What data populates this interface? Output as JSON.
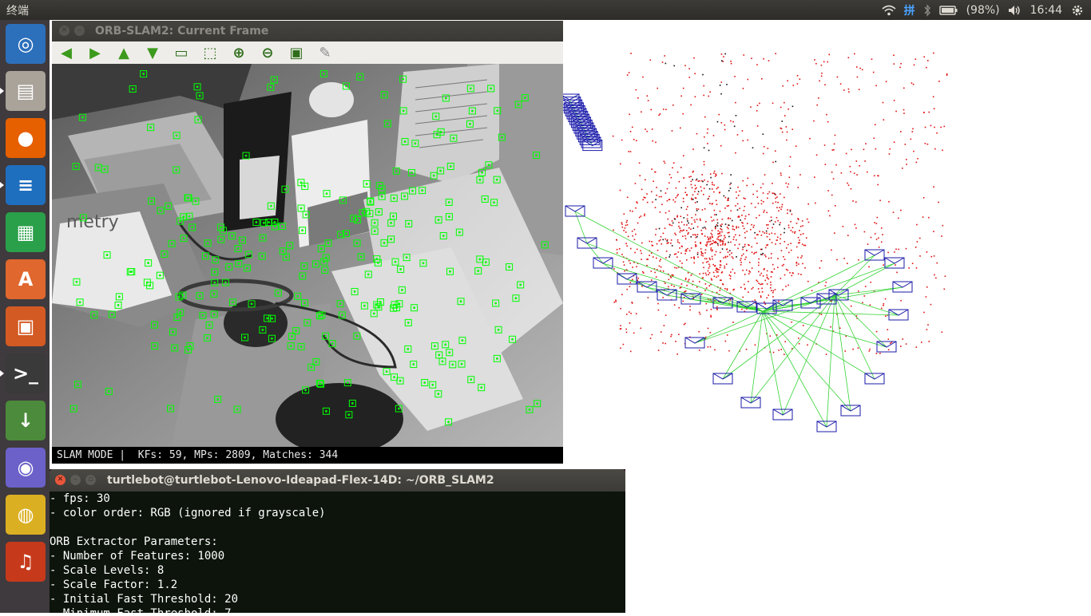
{
  "topbar": {
    "app_name": "终端",
    "battery": "(98%)",
    "clock": "16:44",
    "icons": [
      "wifi-icon",
      "input-method-icon",
      "bluetooth-icon",
      "battery-icon",
      "volume-icon",
      "settings-gear-icon"
    ],
    "ime_label": "拼"
  },
  "launcher": {
    "items": [
      {
        "name": "ubuntu-dash",
        "glyph": "◎",
        "color": "#2c6fbb"
      },
      {
        "name": "files",
        "glyph": "▤",
        "color": "#a9a39a"
      },
      {
        "name": "firefox",
        "glyph": "●",
        "color": "#e66000"
      },
      {
        "name": "libreoffice-writer",
        "glyph": "≡",
        "color": "#1f6fbf"
      },
      {
        "name": "libreoffice-calc",
        "glyph": "▦",
        "color": "#2aa04a"
      },
      {
        "name": "software-center",
        "glyph": "A",
        "color": "#e0672e"
      },
      {
        "name": "libreoffice-impress",
        "glyph": "▣",
        "color": "#d35a23"
      },
      {
        "name": "terminal",
        "glyph": ">_",
        "color": "#3a3a3a"
      },
      {
        "name": "app-generic-1",
        "glyph": "↓",
        "color": "#4b8b3b"
      },
      {
        "name": "app-generic-2",
        "glyph": "◉",
        "color": "#6b61c9"
      },
      {
        "name": "chrome",
        "glyph": "◍",
        "color": "#dbaf22"
      },
      {
        "name": "app-generic-3",
        "glyph": "♫",
        "color": "#c63a1b"
      }
    ]
  },
  "frame_window": {
    "title": "ORB-SLAM2: Current Frame",
    "status": "SLAM MODE |  KFs: 59, MPs: 2809, Matches: 344",
    "toolbar": [
      {
        "name": "pan-left-button",
        "glyph": "◀"
      },
      {
        "name": "pan-right-button",
        "glyph": "▶"
      },
      {
        "name": "pan-up-button",
        "glyph": "▲"
      },
      {
        "name": "pan-down-button",
        "glyph": "▼"
      },
      {
        "name": "image-button",
        "glyph": "▭"
      },
      {
        "name": "zoom-region-button",
        "glyph": "⬚"
      },
      {
        "name": "zoom-in-button",
        "glyph": "⊕"
      },
      {
        "name": "zoom-out-button",
        "glyph": "⊖"
      },
      {
        "name": "save-button",
        "glyph": "▣"
      },
      {
        "name": "brush-button",
        "glyph": "✎"
      }
    ]
  },
  "terminal": {
    "title": "turtlebot@turtlebot-Lenovo-Ideapad-Flex-14D: ~/ORB_SLAM2",
    "lines": [
      "- fps: 30",
      "- color order: RGB (ignored if grayscale)",
      "",
      "ORB Extractor Parameters:",
      "- Number of Features: 1000",
      "- Scale Levels: 8",
      "- Scale Factor: 1.2",
      "- Initial Fast Threshold: 20",
      "- Minimum Fast Threshold: 7"
    ]
  },
  "colors": {
    "feature_green": "#00ff00",
    "map_point_red": "#e01010",
    "map_point_black": "#101010",
    "keyframe_blue": "#1a1aaa",
    "graph_green": "#36d436",
    "launcher_bg": "#3f3a3d",
    "topbar_bg": "#2d2c29",
    "terminal_bg": "#0c140c"
  }
}
